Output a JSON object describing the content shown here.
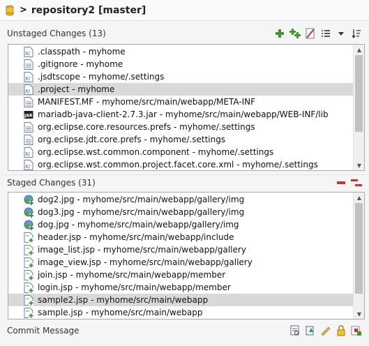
{
  "header": {
    "chevron": ">",
    "title": "repository2 [master]"
  },
  "unstaged": {
    "title": "Unstaged Changes (13)",
    "files": [
      {
        "label": ".classpath - myhome",
        "icon": "xml-file-icon",
        "selected": false
      },
      {
        "label": ".gitignore - myhome",
        "icon": "text-file-icon",
        "selected": false
      },
      {
        "label": ".jsdtscope - myhome/.settings",
        "icon": "xml-file-icon",
        "selected": false
      },
      {
        "label": ".project - myhome",
        "icon": "xml-file-icon",
        "selected": true
      },
      {
        "label": "MANIFEST.MF - myhome/src/main/webapp/META-INF",
        "icon": "text-file-icon",
        "selected": false
      },
      {
        "label": "mariadb-java-client-2.7.3.jar - myhome/src/main/webapp/WEB-INF/lib",
        "icon": "jar-file-icon",
        "selected": false
      },
      {
        "label": "org.eclipse.core.resources.prefs - myhome/.settings",
        "icon": "text-file-icon",
        "selected": false
      },
      {
        "label": "org.eclipse.jdt.core.prefs - myhome/.settings",
        "icon": "text-file-icon",
        "selected": false
      },
      {
        "label": "org.eclipse.wst.common.component - myhome/.settings",
        "icon": "xml-file-icon",
        "selected": false
      },
      {
        "label": "org.eclipse.wst.common.project.facet.core.xml - myhome/.settings",
        "icon": "xml-file-icon",
        "selected": false
      }
    ]
  },
  "staged": {
    "title": "Staged Changes (31)",
    "files": [
      {
        "label": "dog2.jpg - myhome/src/main/webapp/gallery/img",
        "icon": "image-added-icon",
        "selected": false
      },
      {
        "label": "dog3.jpg - myhome/src/main/webapp/gallery/img",
        "icon": "image-added-icon",
        "selected": false
      },
      {
        "label": "dog.jpg - myhome/src/main/webapp/gallery/img",
        "icon": "image-added-icon",
        "selected": false
      },
      {
        "label": "header.jsp - myhome/src/main/webapp/include",
        "icon": "file-added-icon",
        "selected": false
      },
      {
        "label": "image_list.jsp - myhome/src/main/webapp/gallery",
        "icon": "file-added-icon",
        "selected": false
      },
      {
        "label": "image_view.jsp - myhome/src/main/webapp/gallery",
        "icon": "file-added-icon",
        "selected": false
      },
      {
        "label": "join.jsp - myhome/src/main/webapp/member",
        "icon": "file-added-icon",
        "selected": false
      },
      {
        "label": "login.jsp - myhome/src/main/webapp/member",
        "icon": "file-added-icon",
        "selected": false
      },
      {
        "label": "sample2.jsp - myhome/src/main/webapp",
        "icon": "file-added-icon",
        "selected": true
      },
      {
        "label": "sample.jsp - myhome/src/main/webapp",
        "icon": "file-added-icon",
        "selected": false
      }
    ]
  },
  "commit": {
    "title": "Commit Message"
  },
  "colors": {
    "add_green": "#3c9a2a",
    "remove_red": "#d0312d",
    "selected_row": "#d9d9d9"
  }
}
